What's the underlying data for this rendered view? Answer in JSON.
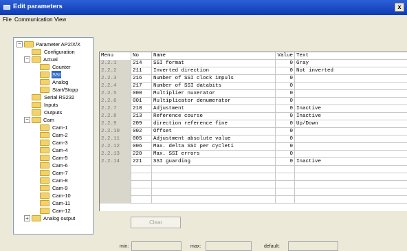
{
  "window": {
    "title": "Edit parameters",
    "close_glyph": "x"
  },
  "menubar": {
    "file": "File",
    "communication": "Communication",
    "view": "View"
  },
  "tree": {
    "root": "Parameter AP2/X/X",
    "items": [
      "Configuration",
      "Actual",
      "Counter",
      "SSI",
      "Analog",
      "Start/Stopp",
      "Serial RS232",
      "Inputs",
      "Outputs",
      "Cam",
      "Cam-1",
      "Cam-2",
      "Cam-3",
      "Cam-4",
      "Cam-5",
      "Cam-6",
      "Cam-7",
      "Cam-8",
      "Cam-9",
      "Cam-10",
      "Cam-11",
      "Cam-12",
      "Analog output"
    ],
    "selected": "SSI"
  },
  "grid": {
    "headers": {
      "menu": "Menu",
      "no": "No",
      "name": "Name",
      "value": "Value",
      "text": "Text"
    },
    "rows": [
      {
        "menu": "2.2.1",
        "no": "214",
        "name": "SSI format",
        "value": "0",
        "text": "Gray"
      },
      {
        "menu": "2.2.2",
        "no": "211",
        "name": "Inverted direction",
        "value": "0",
        "text": "Not inverted"
      },
      {
        "menu": "2.2.3",
        "no": "216",
        "name": "Number of SSI clock impuls",
        "value": "0",
        "text": ""
      },
      {
        "menu": "2.2.4",
        "no": "217",
        "name": "Number of SSI databits",
        "value": "0",
        "text": ""
      },
      {
        "menu": "2.2.5",
        "no": "000",
        "name": "Multiplier nuxerator",
        "value": "0",
        "text": ""
      },
      {
        "menu": "2.2.6",
        "no": "001",
        "name": "Multiplicator denumerator",
        "value": "0",
        "text": ""
      },
      {
        "menu": "2.2.7",
        "no": "218",
        "name": "Adjustment",
        "value": "0",
        "text": "Inactive"
      },
      {
        "menu": "2.2.8",
        "no": "213",
        "name": "Reference course",
        "value": "0",
        "text": "Inactive"
      },
      {
        "menu": "2.2.9",
        "no": "209",
        "name": "direction reference fine",
        "value": "0",
        "text": "Up/Down"
      },
      {
        "menu": "2.2.10",
        "no": "002",
        "name": "Offset",
        "value": "0",
        "text": ""
      },
      {
        "menu": "2.2.11",
        "no": "005",
        "name": "Adjustment absolute value",
        "value": "0",
        "text": ""
      },
      {
        "menu": "2.2.12",
        "no": "006",
        "name": "Max. delta SSI per cycleti",
        "value": "0",
        "text": ""
      },
      {
        "menu": "2.2.13",
        "no": "220",
        "name": "Max. SSI errors",
        "value": "0",
        "text": ""
      },
      {
        "menu": "2.2.14",
        "no": "221",
        "name": "SSI guarding",
        "value": "0",
        "text": "Inactive"
      }
    ]
  },
  "buttons": {
    "clear": "Clear"
  },
  "status": {
    "min_label": "min:",
    "max_label": "max:",
    "default_label": "default:"
  }
}
